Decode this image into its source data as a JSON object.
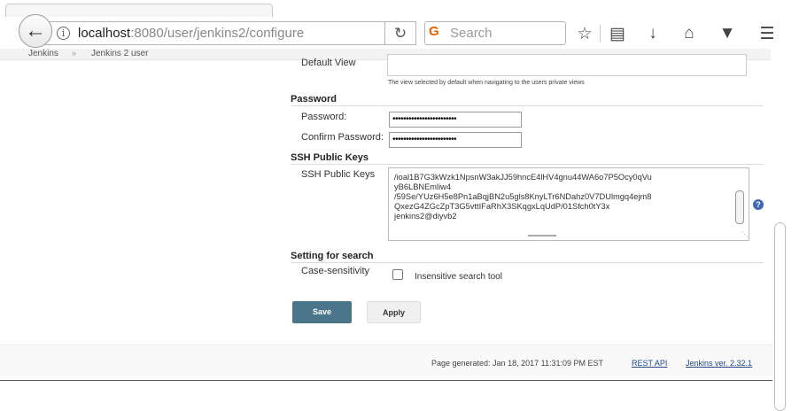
{
  "browser": {
    "url_host": "localhost",
    "url_rest": ":8080/user/jenkins2/configure",
    "search_placeholder": "Search",
    "icons": [
      "back-arrow-icon",
      "info-icon",
      "reload-icon",
      "search-engine-icon",
      "star-icon",
      "reading-list-icon",
      "download-icon",
      "home-icon",
      "pocket-icon",
      "menu-icon"
    ]
  },
  "breadcrumb": {
    "items": [
      "Jenkins",
      "Jenkins 2 user"
    ],
    "separator": "»"
  },
  "form": {
    "default_view_label": "Default View",
    "default_view_hint": "The view selected by default when navigating to the users private views",
    "password_section": "Password",
    "password_label": "Password:",
    "password_value": "••••••••••••••••••••••••",
    "confirm_label": "Confirm Password:",
    "confirm_value": "••••••••••••••••••••••••",
    "ssh_section": "SSH Public Keys",
    "ssh_label": "SSH Public Keys",
    "ssh_value": "/ioal1B7G3kWzk1NpsnW3akJJ59hncE4lHV4gnu44WA6o7P5Ocy0qVu\nyB6LBNEmliw4\n/59Se/YUz6H5e8Pn1aBqjBN2u5gls8KnyLTr6NDahz0V7DUlmgq4ejm8\nQxezG4ZGcZpT3G5vttIFaRhX3SKqgxLqUdP/01Sfch0tY3x\njenkins2@diyvb2",
    "search_section": "Setting for search",
    "case_label": "Case-sensitivity",
    "insensitive_label": "Insensitive search tool",
    "insensitive_checked": false,
    "save_label": "Save",
    "apply_label": "Apply"
  },
  "footer": {
    "generated": "Page generated: Jan 18, 2017 11:31:09 PM EST",
    "rest_api": "REST API",
    "version": "Jenkins ver. 2.32.1"
  },
  "colors": {
    "save_button": "#4b758b",
    "link": "#204a87",
    "help_icon": "#3d6ab0"
  }
}
